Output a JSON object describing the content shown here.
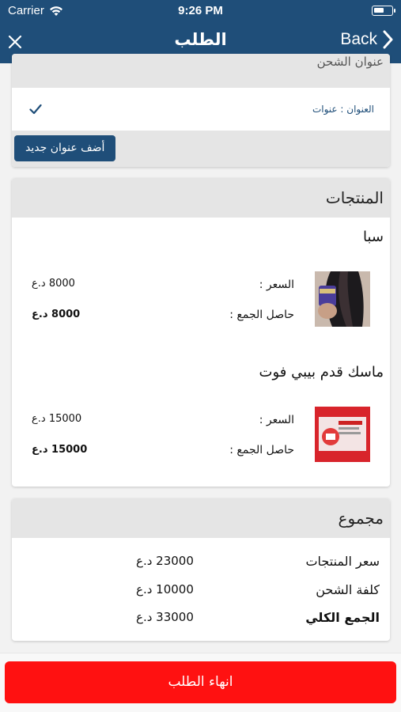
{
  "status_bar": {
    "carrier": "Carrier",
    "time": "9:26 PM"
  },
  "nav": {
    "title": "الطلب",
    "back_label": "Back"
  },
  "address_section": {
    "header_partial": "عنوان الشحن",
    "address_text": "العنوان : عنوات",
    "add_button": "أضف عنوان جديد"
  },
  "products_section": {
    "title": "المنتجات",
    "price_label": "السعر  :",
    "subtotal_label": "حاصل الجمع :",
    "items": [
      {
        "name": "سبا",
        "price": "8000 د.ع",
        "subtotal": "8000 د.ع",
        "image_icon": "hair-product-photo"
      },
      {
        "name": "ماسك قدم بيبي فوت",
        "price": "15000 د.ع",
        "subtotal": "15000 د.ع",
        "image_icon": "baby-foot-box-photo"
      }
    ]
  },
  "summary_section": {
    "title": "مجموع",
    "rows": [
      {
        "label": "سعر المنتجات",
        "value": "23000 د.ع"
      },
      {
        "label": "كلفة الشحن",
        "value": "10000 د.ع"
      },
      {
        "label": "الجمع الكلي",
        "value": "33000 د.ع"
      }
    ]
  },
  "finish_button": "انهاء الطلب",
  "colors": {
    "nav": "#1f4e79",
    "accent": "#1f4e79",
    "finish": "#ff1111",
    "section_header": "#e5e5e5"
  }
}
